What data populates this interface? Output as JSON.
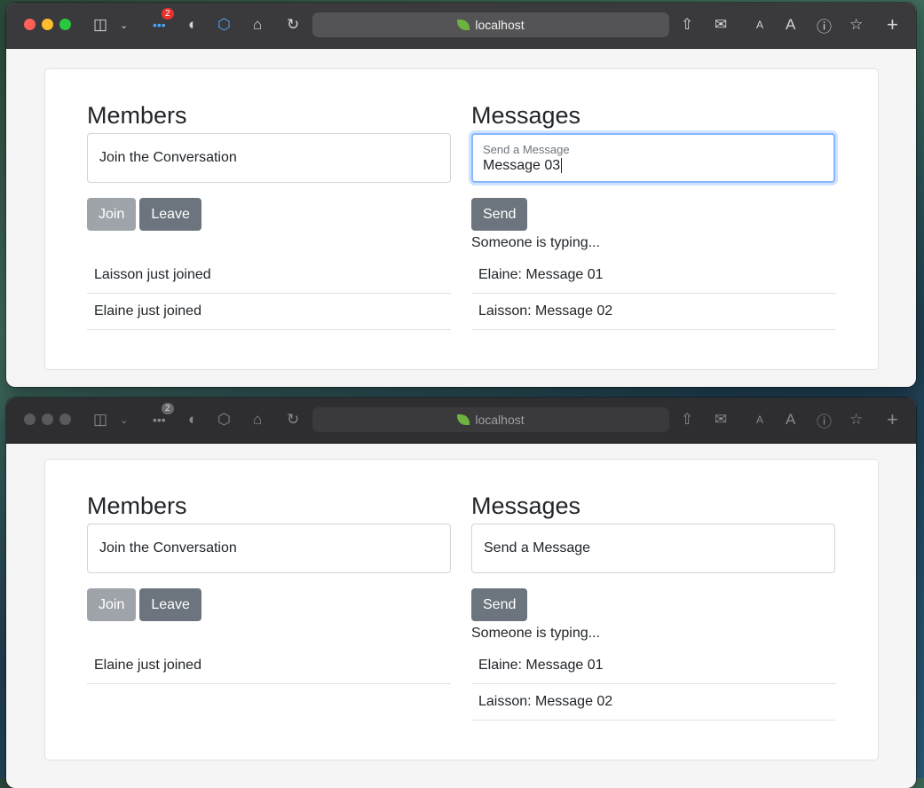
{
  "browser": {
    "address": "localhost",
    "notification_count_1": "2",
    "notification_count_2": "2",
    "text_small": "A",
    "text_large": "A"
  },
  "window1": {
    "members": {
      "heading": "Members",
      "input_placeholder": "Join the Conversation",
      "join_label": "Join",
      "leave_label": "Leave",
      "items": [
        "Laisson just joined",
        "Elaine just joined"
      ]
    },
    "messages": {
      "heading": "Messages",
      "input_label": "Send a Message",
      "input_value": "Message 03",
      "send_label": "Send",
      "typing": "Someone is typing...",
      "items": [
        "Elaine: Message 01",
        "Laisson: Message 02"
      ]
    }
  },
  "window2": {
    "members": {
      "heading": "Members",
      "input_placeholder": "Join the Conversation",
      "join_label": "Join",
      "leave_label": "Leave",
      "items": [
        "Elaine just joined"
      ]
    },
    "messages": {
      "heading": "Messages",
      "input_placeholder": "Send a Message",
      "send_label": "Send",
      "typing": "Someone is typing...",
      "items": [
        "Elaine: Message 01",
        "Laisson: Message 02"
      ]
    }
  }
}
